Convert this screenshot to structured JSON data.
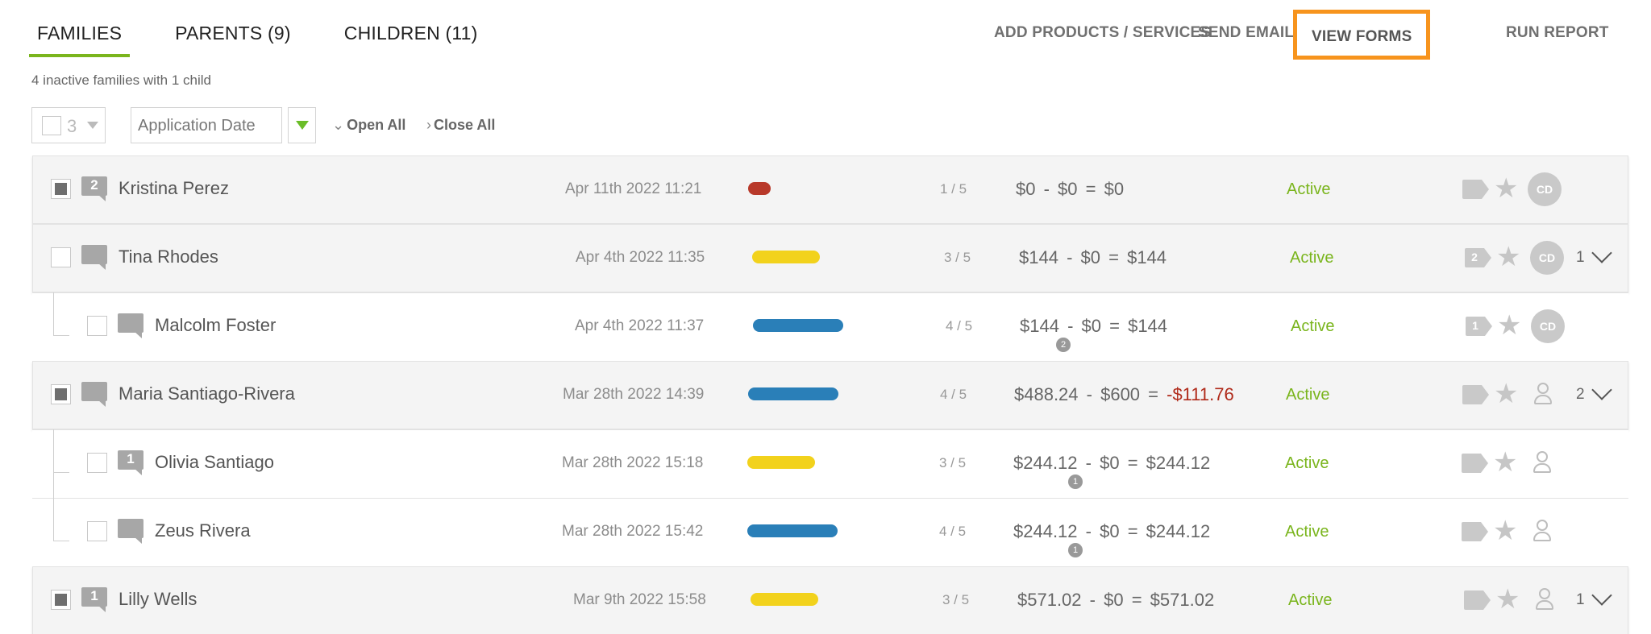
{
  "tabs": [
    {
      "label": "FAMILIES",
      "active": true
    },
    {
      "label": "PARENTS (9)",
      "active": false
    },
    {
      "label": "CHILDREN (11)",
      "active": false
    }
  ],
  "actions": {
    "add_products": "ADD PRODUCTS / SERVICES",
    "send_email": "SEND EMAIL",
    "view_forms": "VIEW FORMS",
    "run_report": "RUN REPORT"
  },
  "summary": "4 inactive families with 1 child",
  "controls": {
    "selected_count": "3",
    "sort_field": "Application Date",
    "open_all": "Open All",
    "close_all": "Close All"
  },
  "colors": {
    "accent_green": "#7ab51d",
    "highlight_orange": "#f7941d",
    "progress_red": "#b8392a",
    "progress_yellow": "#f2d21c",
    "progress_blue": "#2a7fb8",
    "negative_red": "#b02a1a"
  },
  "rows": [
    {
      "type": "family",
      "checked": true,
      "comments": "2",
      "name": "Kristina Perez",
      "date": "Apr 11th 2022 11:21",
      "progress_color": "red",
      "progress_fraction": 0.2,
      "step": "1 / 5",
      "total": "$0",
      "minus": "$0",
      "balance": "$0",
      "status": "Active",
      "tag": "",
      "icon": "avatar",
      "avatar": "CD",
      "child_count": ""
    },
    {
      "type": "family",
      "checked": false,
      "comments": "",
      "name": "Tina Rhodes",
      "date": "Apr 4th 2022 11:35",
      "progress_color": "yellow",
      "progress_fraction": 0.6,
      "step": "3 / 5",
      "total": "$144",
      "minus": "$0",
      "balance": "$144",
      "status": "Active",
      "tag": "2",
      "icon": "avatar",
      "avatar": "CD",
      "child_count": "1"
    },
    {
      "type": "child",
      "checked": false,
      "comments": "",
      "name": "Malcolm Foster",
      "date": "Apr 4th 2022 11:37",
      "progress_color": "blue",
      "progress_fraction": 0.8,
      "step": "4 / 5",
      "total": "$144",
      "total_badge": "2",
      "minus": "$0",
      "balance": "$144",
      "status": "Active",
      "tag": "1",
      "icon": "avatar",
      "avatar": "CD",
      "child_count": ""
    },
    {
      "type": "family",
      "checked": true,
      "comments": "",
      "name": "Maria Santiago-Rivera",
      "date": "Mar 28th 2022 14:39",
      "progress_color": "blue",
      "progress_fraction": 0.8,
      "step": "4 / 5",
      "total": "$488.24",
      "minus": "$600",
      "balance": "-$111.76",
      "balance_negative": true,
      "status": "Active",
      "tag": "",
      "icon": "person",
      "avatar": "",
      "child_count": "2"
    },
    {
      "type": "child",
      "checked": false,
      "comments": "1",
      "name": "Olivia Santiago",
      "date": "Mar 28th 2022 15:18",
      "progress_color": "yellow",
      "progress_fraction": 0.6,
      "step": "3 / 5",
      "total": "$244.12",
      "total_badge": "1",
      "minus": "$0",
      "balance": "$244.12",
      "status": "Active",
      "tag": "",
      "icon": "person",
      "avatar": "",
      "child_count": ""
    },
    {
      "type": "child",
      "checked": false,
      "comments": "",
      "name": "Zeus Rivera",
      "date": "Mar 28th 2022 15:42",
      "progress_color": "blue",
      "progress_fraction": 0.8,
      "step": "4 / 5",
      "total": "$244.12",
      "total_badge": "1",
      "minus": "$0",
      "balance": "$244.12",
      "status": "Active",
      "tag": "",
      "icon": "person",
      "avatar": "",
      "child_count": ""
    },
    {
      "type": "family",
      "checked": true,
      "comments": "1",
      "name": "Lilly Wells",
      "date": "Mar 9th 2022 15:58",
      "progress_color": "yellow",
      "progress_fraction": 0.6,
      "step": "3 / 5",
      "total": "$571.02",
      "minus": "$0",
      "balance": "$571.02",
      "status": "Active",
      "tag": "",
      "icon": "person",
      "avatar": "",
      "child_count": "1"
    }
  ]
}
